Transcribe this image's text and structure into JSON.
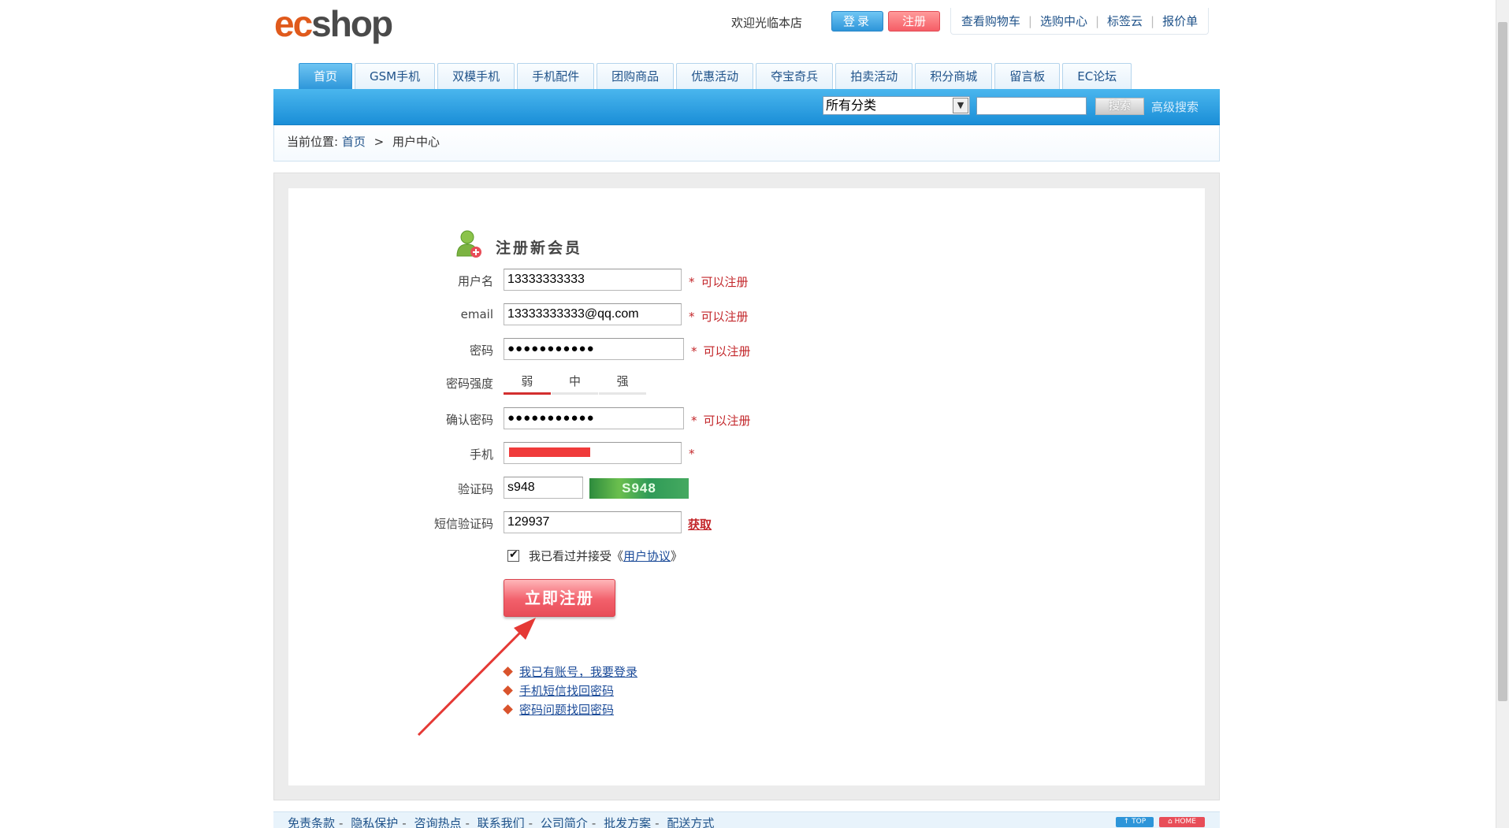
{
  "header": {
    "logo_ec": "ec",
    "logo_shop": "shop",
    "welcome": "欢迎光临本店",
    "login": "登录",
    "register": "注册",
    "toplinks": [
      "查看购物车",
      "选购中心",
      "标签云",
      "报价单"
    ]
  },
  "nav": {
    "tabs": [
      "首页",
      "GSM手机",
      "双模手机",
      "手机配件",
      "团购商品",
      "优惠活动",
      "夺宝奇兵",
      "拍卖活动",
      "积分商城",
      "留言板",
      "EC论坛"
    ],
    "active": 0
  },
  "search": {
    "category": "所有分类",
    "button": "搜索",
    "advanced": "高级搜索"
  },
  "breadcrumb": {
    "prefix": "当前位置:",
    "home": "首页",
    "gt": ">",
    "current": "用户中心"
  },
  "form": {
    "title": "注册新会员",
    "username_label": "用户名",
    "username_value": "13333333333",
    "email_label": "email",
    "email_value": "13333333333@qq.com",
    "password_label": "密码",
    "password_value": "●●●●●●●●●●●",
    "strength_label": "密码强度",
    "strength_levels": [
      "弱",
      "中",
      "强"
    ],
    "confirm_label": "确认密码",
    "confirm_value": "●●●●●●●●●●●",
    "phone_label": "手机",
    "captcha_label": "验证码",
    "captcha_value": "s948",
    "captcha_image_text": "S948",
    "sms_label": "短信验证码",
    "sms_value": "129937",
    "get_code": "获取",
    "star": "*",
    "ok_text": "可以注册",
    "agree_text": "我已看过并接受《",
    "agree_link": "用户协议",
    "agree_end": "》",
    "submit": "立即注册",
    "links": [
      "我已有账号，我要登录",
      "手机短信找回密码",
      "密码问题找回密码"
    ]
  },
  "footer": {
    "links": [
      "免责条款",
      "隐私保护",
      "咨询热点",
      "联系我们",
      "公司简介",
      "批发方案",
      "配送方式"
    ],
    "top": "↑ TOP",
    "home": "⌂ HOME"
  },
  "colors": {
    "accent_blue": "#2e97da",
    "accent_red": "#e84d58",
    "ok_red": "#c3272b",
    "link_blue": "#20538a"
  }
}
